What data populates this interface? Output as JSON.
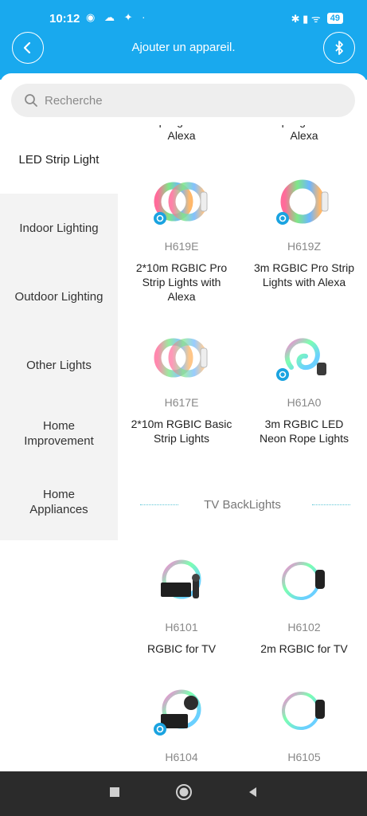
{
  "status": {
    "time": "10:12",
    "left_icons": "◉ ☁ ✦ ·",
    "right_icons": "✱ ▮ ᯤ",
    "battery": "49"
  },
  "header": {
    "title": "Ajouter un appareil.",
    "back_icon": "chevron-left-icon",
    "bluetooth_icon": "bluetooth-icon"
  },
  "search": {
    "placeholder": "Recherche"
  },
  "sidebar": {
    "items": [
      {
        "label": "LED Strip Light",
        "active": true
      },
      {
        "label": "Indoor Lighting"
      },
      {
        "label": "Outdoor Lighting"
      },
      {
        "label": "Other Lights"
      },
      {
        "label": "Home\nImprovement"
      },
      {
        "label": "Home\nAppliances"
      }
    ]
  },
  "products_top_cut": [
    {
      "name": "Strip Lights with\nAlexa"
    },
    {
      "name": "Strip Lights with\nAlexa"
    }
  ],
  "products": [
    {
      "model": "H619E",
      "name": "2*10m RGBIC Pro\nStrip Lights with\nAlexa",
      "alexa": true
    },
    {
      "model": "H619Z",
      "name": "3m RGBIC Pro Strip\nLights with Alexa",
      "alexa": true
    },
    {
      "model": "H617E",
      "name": "2*10m RGBIC Basic\nStrip Lights",
      "alexa": false
    },
    {
      "model": "H61A0",
      "name": "3m RGBIC LED\nNeon Rope Lights",
      "alexa": true
    }
  ],
  "section": {
    "title": "TV BackLights"
  },
  "tv_products": [
    {
      "model": "H6101",
      "name": "RGBIC for TV"
    },
    {
      "model": "H6102",
      "name": "2m RGBIC for TV"
    },
    {
      "model": "H6104",
      "name": ""
    },
    {
      "model": "H6105",
      "name": ""
    }
  ],
  "navbar": {
    "square_icon": "square-icon",
    "home_icon": "circle-home-icon",
    "back_icon": "triangle-back-icon"
  }
}
